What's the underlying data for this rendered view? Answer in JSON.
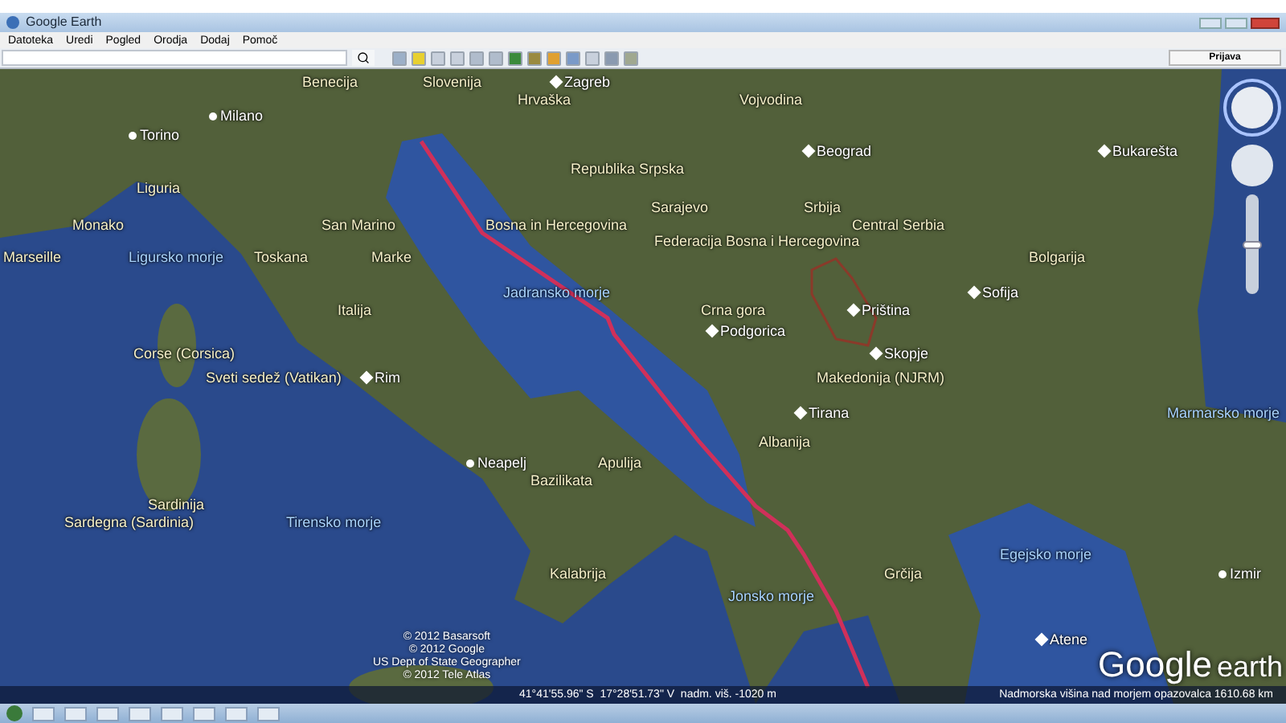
{
  "window": {
    "title": "Google Earth"
  },
  "menu": [
    "Datoteka",
    "Uredi",
    "Pogled",
    "Orodja",
    "Dodaj",
    "Pomoč"
  ],
  "toolbar": {
    "sign_in": "Prijava"
  },
  "map_labels": [
    {
      "text": "Benecija",
      "kind": "region"
    },
    {
      "text": "Slovenija",
      "kind": "region"
    },
    {
      "text": "Zagreb",
      "kind": "capital"
    },
    {
      "text": "Hrvaška",
      "kind": "region"
    },
    {
      "text": "Vojvodina",
      "kind": "region"
    },
    {
      "text": "Milano",
      "kind": "city"
    },
    {
      "text": "Torino",
      "kind": "city"
    },
    {
      "text": "Beograd",
      "kind": "capital"
    },
    {
      "text": "Bukarešta",
      "kind": "capital"
    },
    {
      "text": "Republika Srpska",
      "kind": "region"
    },
    {
      "text": "Liguria",
      "kind": "region"
    },
    {
      "text": "Sarajevo",
      "kind": "region"
    },
    {
      "text": "Srbija",
      "kind": "region"
    },
    {
      "text": "Monako",
      "kind": "region"
    },
    {
      "text": "San Marino",
      "kind": "region"
    },
    {
      "text": "Bosna in Hercegovina",
      "kind": "region"
    },
    {
      "text": "Central Serbia",
      "kind": "region"
    },
    {
      "text": "Federacija Bosna i Hercegovina",
      "kind": "region"
    },
    {
      "text": "Marseille",
      "kind": "region"
    },
    {
      "text": "Ligursko morje",
      "kind": "sea"
    },
    {
      "text": "Toskana",
      "kind": "region"
    },
    {
      "text": "Marke",
      "kind": "region"
    },
    {
      "text": "Bolgarija",
      "kind": "region"
    },
    {
      "text": "Jadransko morje",
      "kind": "sea"
    },
    {
      "text": "Sofija",
      "kind": "capital"
    },
    {
      "text": "Italija",
      "kind": "region"
    },
    {
      "text": "Crna gora",
      "kind": "region"
    },
    {
      "text": "Priština",
      "kind": "capital"
    },
    {
      "text": "Podgorica",
      "kind": "capital"
    },
    {
      "text": "Corse (Corsica)",
      "kind": "region"
    },
    {
      "text": "Skopje",
      "kind": "capital"
    },
    {
      "text": "Sveti sedež (Vatikan)",
      "kind": "region"
    },
    {
      "text": "Rim",
      "kind": "capital"
    },
    {
      "text": "Makedonija (NJRM)",
      "kind": "region"
    },
    {
      "text": "Tirana",
      "kind": "capital"
    },
    {
      "text": "Marmarsko morje",
      "kind": "sea"
    },
    {
      "text": "Albanija",
      "kind": "region"
    },
    {
      "text": "Neapelj",
      "kind": "city"
    },
    {
      "text": "Apulija",
      "kind": "region"
    },
    {
      "text": "Bazilikata",
      "kind": "region"
    },
    {
      "text": "Sardinija",
      "kind": "region"
    },
    {
      "text": "Sardegna (Sardinia)",
      "kind": "region"
    },
    {
      "text": "Tirensko morje",
      "kind": "sea"
    },
    {
      "text": "Egejsko morje",
      "kind": "sea"
    },
    {
      "text": "Kalabrija",
      "kind": "region"
    },
    {
      "text": "Grčija",
      "kind": "region"
    },
    {
      "text": "Izmir",
      "kind": "city"
    },
    {
      "text": "Jonsko morje",
      "kind": "sea"
    },
    {
      "text": "Atene",
      "kind": "capital"
    }
  ],
  "attribution": [
    "© 2012 Basarsoft",
    "© 2012 Google",
    "US Dept of State Geographer",
    "© 2012 Tele Atlas"
  ],
  "status_bar": {
    "coordinates": "41°41'55.96\" S  17°28'51.73\" V  nadm. viš. -1020 m",
    "eye_altitude": "Nadmorska višina nad morjem opazovalca 1610.68 km"
  },
  "logo": {
    "brand": "Google",
    "product": "earth"
  },
  "zoom_slider": {
    "level": 0.5
  }
}
